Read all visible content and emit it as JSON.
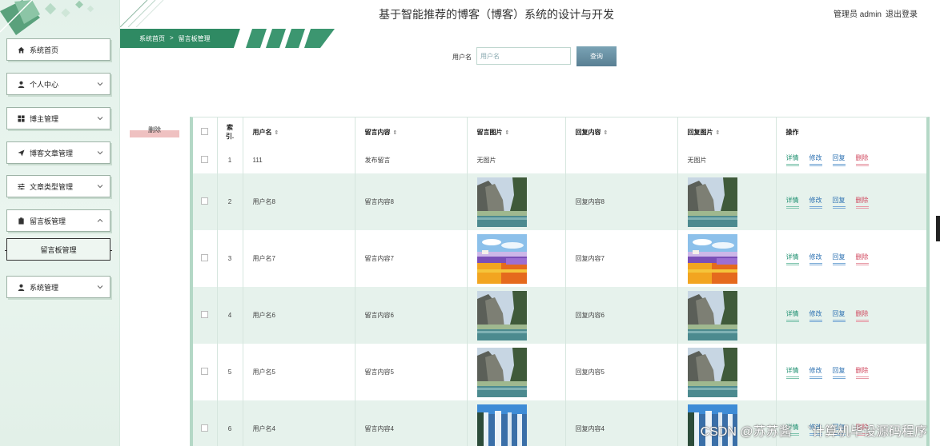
{
  "header": {
    "title": "基于智能推荐的博客（博客）系统的设计与开发",
    "user_label": "管理员 admin",
    "logout": "退出登录"
  },
  "breadcrumb": {
    "home": "系统首页",
    "sep": ">",
    "current": "留言板管理"
  },
  "sidebar": {
    "items": [
      {
        "label": "系统首页",
        "icon": "home-icon"
      },
      {
        "label": "个人中心",
        "icon": "user-icon"
      },
      {
        "label": "博主管理",
        "icon": "grid-icon"
      },
      {
        "label": "博客文章管理",
        "icon": "send-icon"
      },
      {
        "label": "文章类型管理",
        "icon": "sliders-icon"
      },
      {
        "label": "留言板管理",
        "icon": "clipboard-icon"
      },
      {
        "label": "系统管理",
        "icon": "user-icon"
      }
    ],
    "sub_item": "留言板管理"
  },
  "search": {
    "label": "用户名",
    "placeholder": "用户名",
    "button": "查询"
  },
  "toolbar": {
    "delete": "删除"
  },
  "table": {
    "headers": [
      "索引",
      "用户名",
      "留言内容",
      "留言图片",
      "回复内容",
      "回复图片",
      "操作"
    ],
    "index_header": [
      "索",
      "引."
    ],
    "rows": [
      {
        "index": "1",
        "username": "111",
        "content": "发布留言",
        "image": "无图片",
        "reply": "",
        "reply_image": "无图片"
      },
      {
        "index": "2",
        "username": "用户名8",
        "content": "留言内容8",
        "image": "cliff",
        "reply": "回复内容8",
        "reply_image": "cliff"
      },
      {
        "index": "3",
        "username": "用户名7",
        "content": "留言内容7",
        "image": "flowers",
        "reply": "回复内容7",
        "reply_image": "flowers"
      },
      {
        "index": "4",
        "username": "用户名6",
        "content": "留言内容6",
        "image": "cliff",
        "reply": "回复内容6",
        "reply_image": "cliff"
      },
      {
        "index": "5",
        "username": "用户名5",
        "content": "留言内容5",
        "image": "cliff",
        "reply": "回复内容5",
        "reply_image": "cliff"
      },
      {
        "index": "6",
        "username": "用户名4",
        "content": "留言内容4",
        "image": "waterfall",
        "reply": "回复内容4",
        "reply_image": "waterfall"
      }
    ],
    "actions": [
      "详情",
      "修改",
      "回复",
      "删除"
    ]
  },
  "watermark": [
    "CSDN @苏苏酱",
    "`计算机毕设源码程序"
  ],
  "colors": {
    "accent": "#2a8a64",
    "sidebar_bg": "#e3f1ea",
    "search_button": "#6b93a6",
    "delete_bar": "#efc1c1",
    "row_alt": "#e6f2ec"
  }
}
